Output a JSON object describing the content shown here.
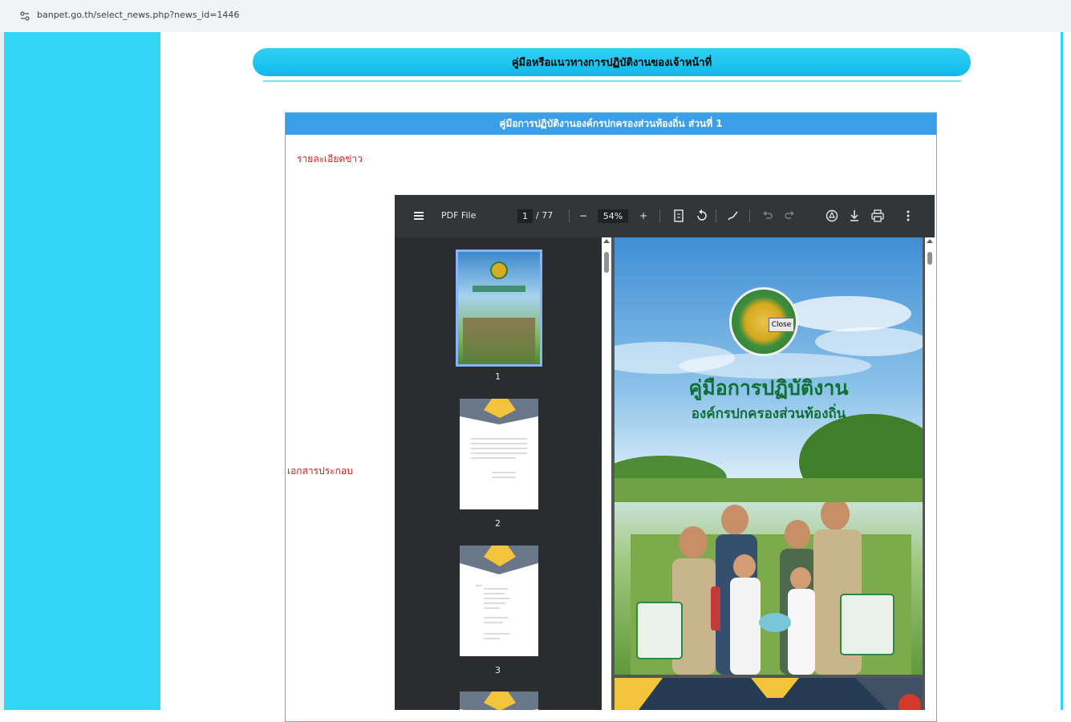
{
  "browser": {
    "url": "banpet.go.th/select_news.php?news_id=1446"
  },
  "section": {
    "title": "คู่มือหรือแนวทางการปฏิบัติงานของเจ้าหน้าที่"
  },
  "news": {
    "header": "คู่มือการปฏิบัติงานองค์กรปกครองส่วนท้องถิ่น ส่วนที่ 1",
    "detail_label": "รายละเอียดข่าว",
    "attachment_label": "เอกสารประกอบ"
  },
  "pdf": {
    "title": "PDF File",
    "current_page": "1",
    "total_pages": "/ 77",
    "zoom": "54%",
    "zoom_out": "−",
    "zoom_in": "+",
    "thumbnails": [
      "1",
      "2",
      "3"
    ],
    "cover": {
      "title": "คู่มือการปฏิบัติงาน",
      "subtitle": "องค์กรปกครองส่วนท้องถิ่น",
      "close_label": "Close"
    }
  }
}
